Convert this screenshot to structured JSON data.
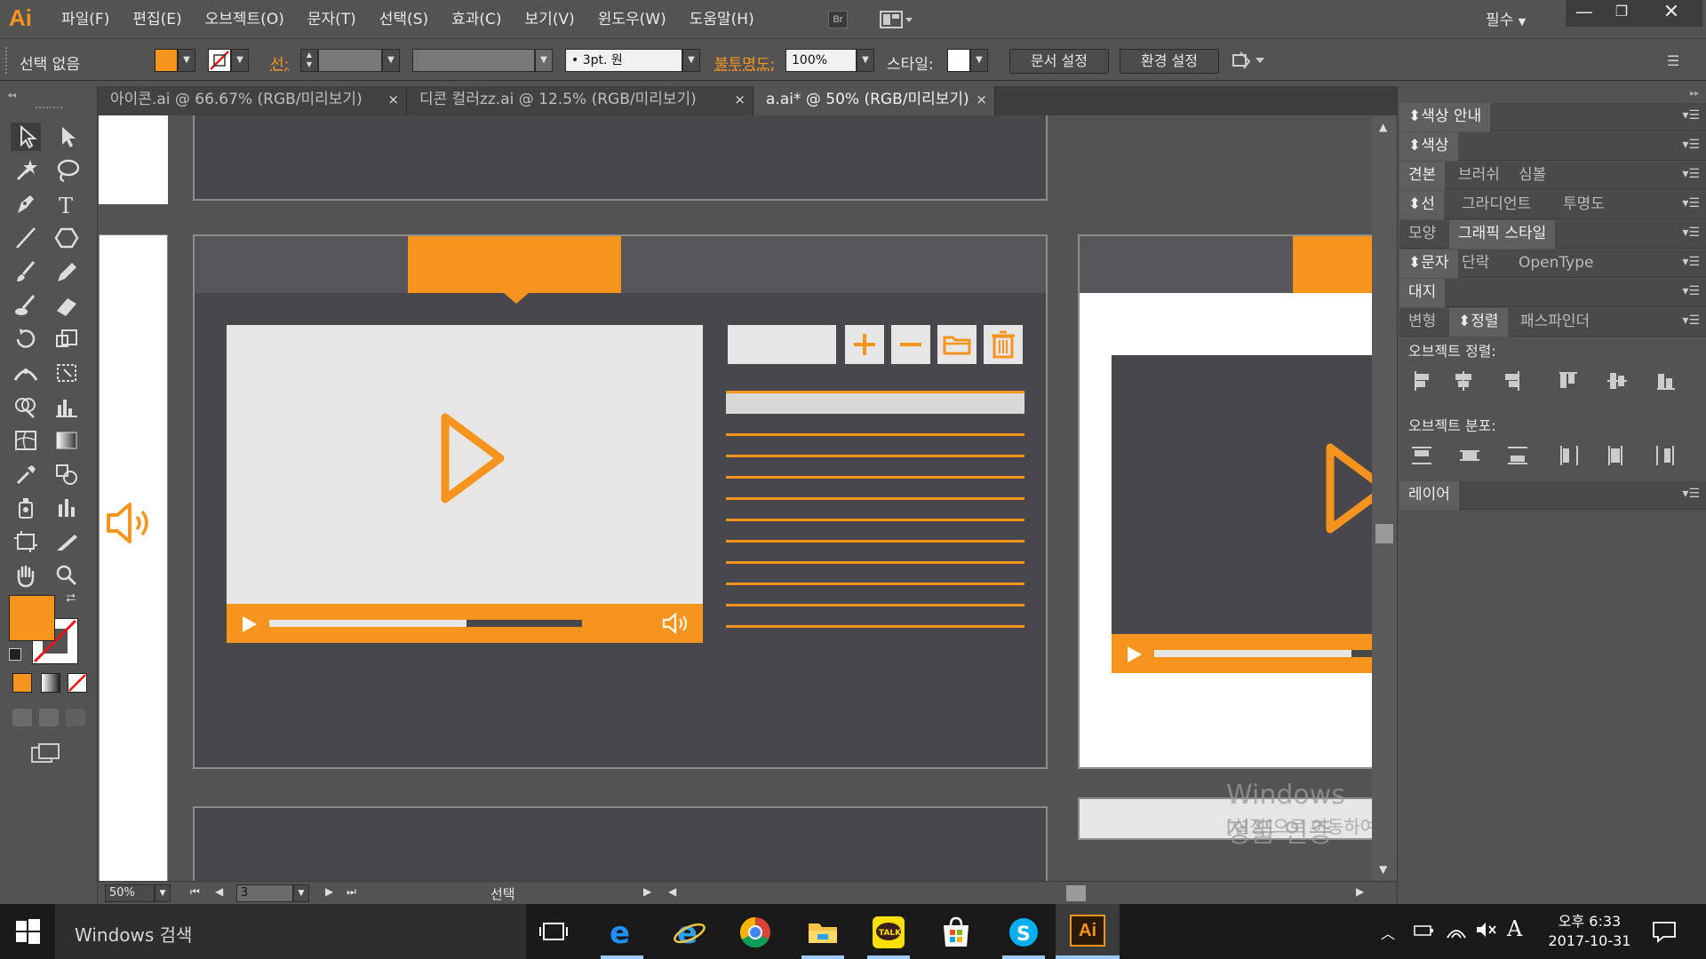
{
  "app": {
    "logo": "Ai",
    "bridge_label": "Br"
  },
  "menus": [
    "파일(F)",
    "편집(E)",
    "오브젝트(O)",
    "문자(T)",
    "선택(S)",
    "효과(C)",
    "보기(V)",
    "윈도우(W)",
    "도움말(H)"
  ],
  "workspace": "필수",
  "window": {
    "minimize": "—",
    "maximize": "❐",
    "close": "✕"
  },
  "control": {
    "selection_label": "선택 없음",
    "stroke_label": "선:",
    "brush_value": "3pt. 원",
    "opacity_label": "불투명도:",
    "opacity_value": "100%",
    "style_label": "스타일:",
    "doc_setup_button": "문서 설정",
    "prefs_button": "환경 설정",
    "fill_color": "#f7941d"
  },
  "tabs": [
    {
      "label": "아이콘.ai @ 66.67% (RGB/미리보기)",
      "close": "×"
    },
    {
      "label": "디콘 컬러zz.ai @ 12.5% (RGB/미리보기)",
      "close": "×"
    },
    {
      "label": "a.ai* @ 50% (RGB/미리보기)",
      "close": "×",
      "active": true
    }
  ],
  "panels": {
    "color_guide": "색상 안내",
    "color": "색상",
    "swatches_tabs": [
      "견본",
      "브러쉬",
      "심볼"
    ],
    "stroke_tabs": [
      "선",
      "그라디언트",
      "투명도"
    ],
    "appearance_tabs": [
      "모양",
      "그래픽 스타일"
    ],
    "type_tabs": [
      "문자",
      "단락",
      "OpenType"
    ],
    "artboard": "대지",
    "transform_tabs": [
      "변형",
      "정렬",
      "패스파인더"
    ],
    "align_objects": "오브젝트 정렬:",
    "distribute_objects": "오브젝트 분포:",
    "layers": "레이어"
  },
  "status": {
    "zoom": "50%",
    "artboard": "3",
    "selection": "선택"
  },
  "watermark": {
    "title": "Windows 정품 인증",
    "subtitle": "[설정]으로 이동하여 Windows를 정품 인증합니다."
  },
  "taskbar": {
    "search": "Windows 검색",
    "time": "오후 6:33",
    "date": "2017-10-31",
    "ime": "A"
  },
  "colors": {
    "accent": "#f7941d",
    "artboard_dark": "#47474c",
    "panel_light": "#e6e6e6"
  }
}
